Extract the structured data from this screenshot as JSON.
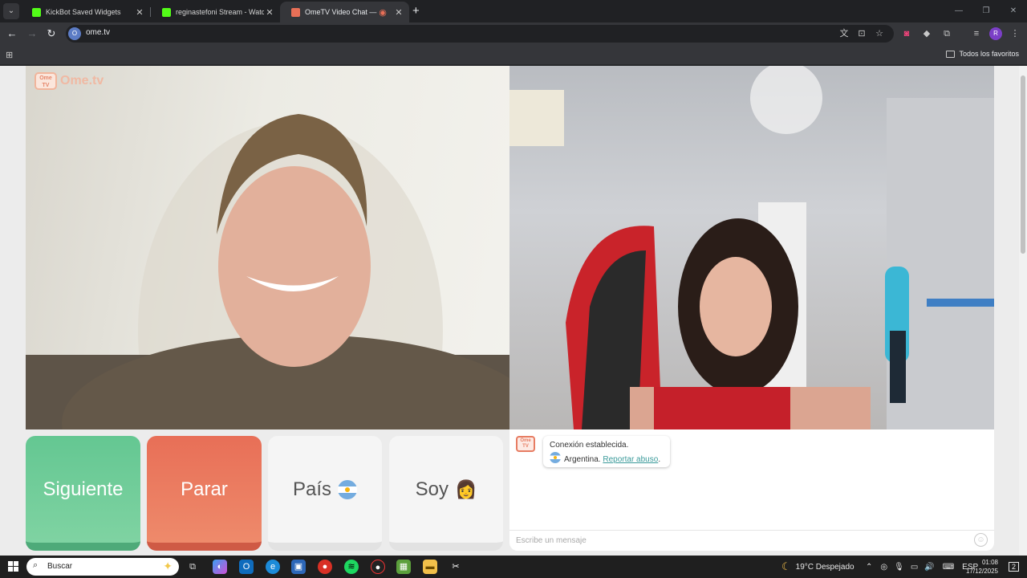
{
  "browser": {
    "tabs": [
      {
        "title": "KickBot Saved Widgets",
        "color": "#53fc18"
      },
      {
        "title": "reginastefoni Stream - Watch Li",
        "color": "#53fc18"
      },
      {
        "title": "OmeTV Video Chat — Ome",
        "color": "#e86f57"
      }
    ],
    "url": "ome.tv",
    "bookmarks_folder": "Todos los favoritos",
    "profile_initial": "R"
  },
  "page": {
    "logo_text": "Ome.tv",
    "logo_badge_top": "Ome",
    "logo_badge_bottom": "TV",
    "buttons": {
      "next": "Siguiente",
      "stop": "Parar",
      "country": "País",
      "gender": "Soy",
      "gender_emoji": "👩"
    },
    "chat": {
      "status": "Conexión establecida.",
      "country": "Argentina.",
      "report": "Reportar abuso",
      "report_suffix": ".",
      "placeholder": "Escribe un mensaje"
    }
  },
  "taskbar": {
    "search": "Buscar",
    "weather": "19°C  Despejado",
    "language": "ESP",
    "time": "01:08",
    "date": "17/12/2025",
    "notifications": "2"
  },
  "colors": {
    "next": "#64c792",
    "stop": "#e86f57",
    "report_link": "#3a9a9a"
  }
}
